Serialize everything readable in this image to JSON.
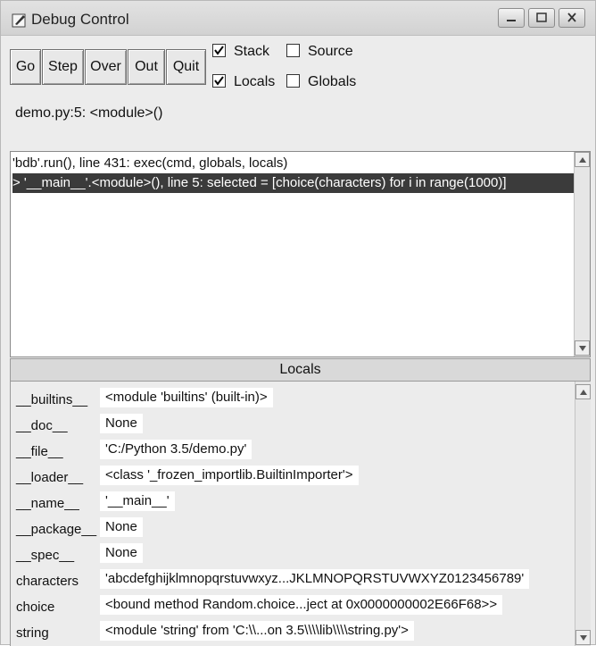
{
  "window": {
    "title": "Debug Control"
  },
  "toolbar": {
    "go_label": "Go",
    "step_label": "Step",
    "over_label": "Over",
    "out_label": "Out",
    "quit_label": "Quit"
  },
  "checkboxes": {
    "stack": {
      "label": "Stack",
      "checked": true
    },
    "source": {
      "label": "Source",
      "checked": false
    },
    "locals": {
      "label": "Locals",
      "checked": true
    },
    "globals": {
      "label": "Globals",
      "checked": false
    }
  },
  "status": {
    "location": "demo.py:5: <module>()"
  },
  "stack": {
    "frames": [
      {
        "text": "'bdb'.run(), line 431: exec(cmd, globals, locals)",
        "selected": false
      },
      {
        "text": "> '__main__'.<module>(), line 5: selected = [choice(characters) for i in range(1000)]",
        "selected": true
      }
    ]
  },
  "locals": {
    "header": "Locals",
    "rows": [
      {
        "name": "__builtins__",
        "value": "<module 'builtins' (built-in)>"
      },
      {
        "name": "__doc__",
        "value": "None"
      },
      {
        "name": "__file__",
        "value": "'C:/Python 3.5/demo.py'"
      },
      {
        "name": "__loader__",
        "value": "<class '_frozen_importlib.BuiltinImporter'>"
      },
      {
        "name": "__name__",
        "value": "'__main__'"
      },
      {
        "name": "__package__",
        "value": "None"
      },
      {
        "name": "__spec__",
        "value": "None"
      },
      {
        "name": "characters",
        "value": "'abcdefghijklmnopqrstuvwxyz...JKLMNOPQRSTUVWXYZ0123456789'"
      },
      {
        "name": "choice",
        "value": "<bound method Random.choice...ject at 0x0000000002E66F68>>"
      },
      {
        "name": "string",
        "value": "<module 'string' from 'C:\\\\...on 3.5\\\\\\\\lib\\\\\\\\string.py'>"
      }
    ]
  },
  "icons": {
    "app": "feather-icon",
    "minimize": "minimize-icon",
    "maximize": "maximize-icon",
    "close": "close-icon",
    "scroll_up": "scroll-up-arrow-icon",
    "scroll_down": "scroll-down-arrow-icon"
  },
  "colors": {
    "selection_bg": "#3b3b3b",
    "selection_fg": "#ffffff"
  }
}
